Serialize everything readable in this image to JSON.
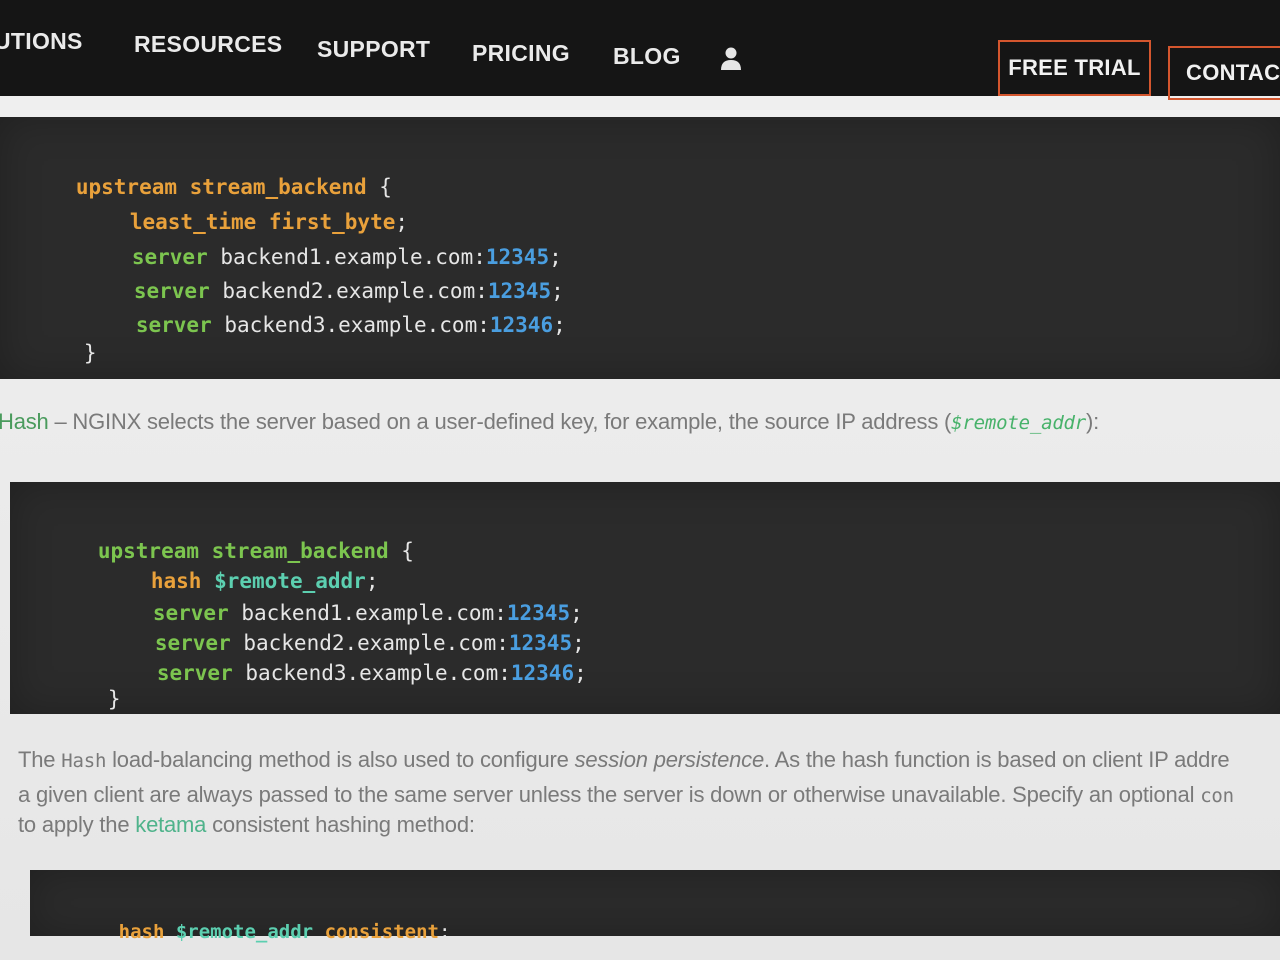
{
  "nav": {
    "items": [
      "UTIONS",
      "RESOURCES",
      "SUPPORT",
      "PRICING",
      "BLOG"
    ],
    "user_icon": "user-icon",
    "free_trial": "FREE TRIAL",
    "contact": "CONTACT"
  },
  "code1": {
    "lines": [
      {
        "kw": "upstream stream_backend",
        "rest": " {"
      },
      {
        "kw": "least_time first_byte",
        "rest": ";"
      },
      {
        "kw": "server",
        "host": " backend1.example.com:",
        "port": "12345",
        "end": ";"
      },
      {
        "kw": "server",
        "host": " backend2.example.com:",
        "port": "12345",
        "end": ";"
      },
      {
        "kw": "server",
        "host": " backend3.example.com:",
        "port": "12346",
        "end": ";"
      },
      {
        "brace": "}"
      }
    ]
  },
  "hash_para": {
    "term": "Hash",
    "dash": " – NGINX selects the server based on a user-defined key, for example, the source IP address (",
    "var": "$remote_addr",
    "end": "):"
  },
  "code2": {
    "lines": [
      {
        "kw": "upstream stream_backend",
        "rest": " {"
      },
      {
        "kw": "hash",
        "var": " $remote_addr",
        "end": ";"
      },
      {
        "kw": "server",
        "host": " backend1.example.com:",
        "port": "12345",
        "end": ";"
      },
      {
        "kw": "server",
        "host": " backend2.example.com:",
        "port": "12345",
        "end": ";"
      },
      {
        "kw": "server",
        "host": " backend3.example.com:",
        "port": "12346",
        "end": ";"
      },
      {
        "brace": "}"
      }
    ]
  },
  "para2": {
    "l1_a": "The ",
    "l1_code": "Hash",
    "l1_b": " load-balancing method is also used to configure ",
    "l1_italic": "session persistence",
    "l1_c": ". As the hash function is based on client IP addre",
    "l2_a": "a given client are always passed to the same server unless the server is down or otherwise unavailable. Specify an optional ",
    "l2_code": "con",
    "l3_a": "to apply the ",
    "l3_link": "ketama",
    "l3_b": " consistent hashing method:"
  },
  "code3": {
    "kw": "hash",
    "var": " $remote_addr",
    "rest": " consistent",
    "end": ";"
  },
  "colors": {
    "accent_orange": "#d4562e",
    "keyword_orange": "#e9a13b",
    "keyword_green": "#7cc54f",
    "number_blue": "#4a9ee0",
    "link_green": "#4fb38b"
  }
}
